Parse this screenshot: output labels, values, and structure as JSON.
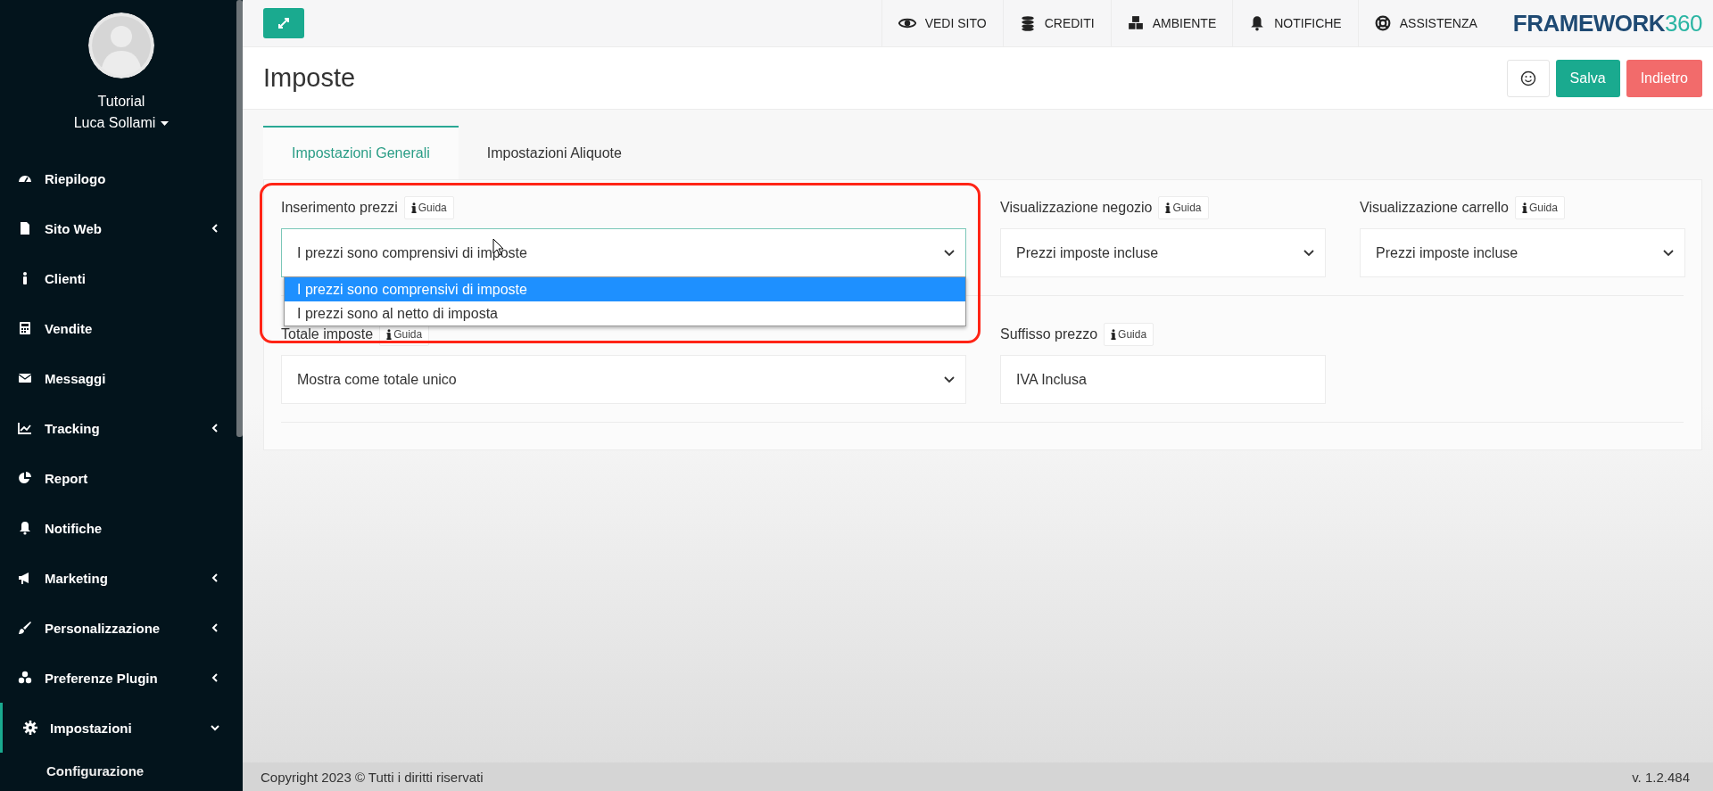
{
  "sidebar": {
    "user": {
      "role": "Tutorial",
      "name": "Luca Sollami"
    },
    "items": [
      {
        "label": "Riepilogo",
        "kind": "link"
      },
      {
        "label": "Sito Web",
        "kind": "group",
        "expanded": false
      },
      {
        "label": "Clienti",
        "kind": "link"
      },
      {
        "label": "Vendite",
        "kind": "link"
      },
      {
        "label": "Messaggi",
        "kind": "link"
      },
      {
        "label": "Tracking",
        "kind": "group",
        "expanded": false
      },
      {
        "label": "Report",
        "kind": "link"
      },
      {
        "label": "Notifiche",
        "kind": "link"
      },
      {
        "label": "Marketing",
        "kind": "group",
        "expanded": false
      },
      {
        "label": "Personalizzazione",
        "kind": "group",
        "expanded": false
      },
      {
        "label": "Preferenze Plugin",
        "kind": "group",
        "expanded": false
      },
      {
        "label": "Impostazioni",
        "kind": "group",
        "expanded": true,
        "children": [
          {
            "label": "Configurazione"
          }
        ]
      }
    ]
  },
  "topbar": {
    "links": [
      {
        "label": "VEDI SITO"
      },
      {
        "label": "CREDITI"
      },
      {
        "label": "AMBIENTE"
      },
      {
        "label": "NOTIFICHE"
      },
      {
        "label": "ASSISTENZA"
      }
    ],
    "logo": {
      "word": "FRAMEWORK",
      "number": "360"
    }
  },
  "header": {
    "title": "Imposte",
    "buttons": [
      {
        "kind": "emoji"
      },
      {
        "kind": "primary",
        "label": "Salva"
      },
      {
        "kind": "danger",
        "label": "Indietro"
      }
    ]
  },
  "tabs": [
    {
      "label": "Impostazioni Generali",
      "selected": true
    },
    {
      "label": "Impostazioni Aliquote",
      "selected": false
    }
  ],
  "form": {
    "rows": [
      {
        "fields": [
          {
            "label": "Inserimento prezzi",
            "help": "Guida",
            "kind": "select",
            "value": "I prezzi sono comprensivi di imposte",
            "highlighted": true,
            "options": [
              {
                "label": "I prezzi sono comprensivi di imposte",
                "selected": true
              },
              {
                "label": "I prezzi sono al netto di imposta",
                "selected": false
              }
            ]
          },
          {
            "label": "Visualizzazione negozio",
            "help": "Guida",
            "kind": "select",
            "value": "Prezzi imposte incluse",
            "highlighted": false
          },
          {
            "label": "Visualizzazione carrello",
            "help": "Guida",
            "kind": "select",
            "value": "Prezzi imposte incluse",
            "highlighted": false
          }
        ]
      },
      {
        "fields": [
          {
            "label": "Totale imposte",
            "help": "Guida",
            "kind": "select",
            "value": "Mostra come totale unico",
            "highlighted": false
          },
          {
            "label": "Suffisso prezzo",
            "help": "Guida",
            "kind": "text",
            "value": "IVA Inclusa",
            "highlighted": false
          }
        ]
      }
    ]
  },
  "footer": {
    "copyright": "Copyright 2023 © Tutti i diritti riservati",
    "version": "v. 1.2.484"
  }
}
